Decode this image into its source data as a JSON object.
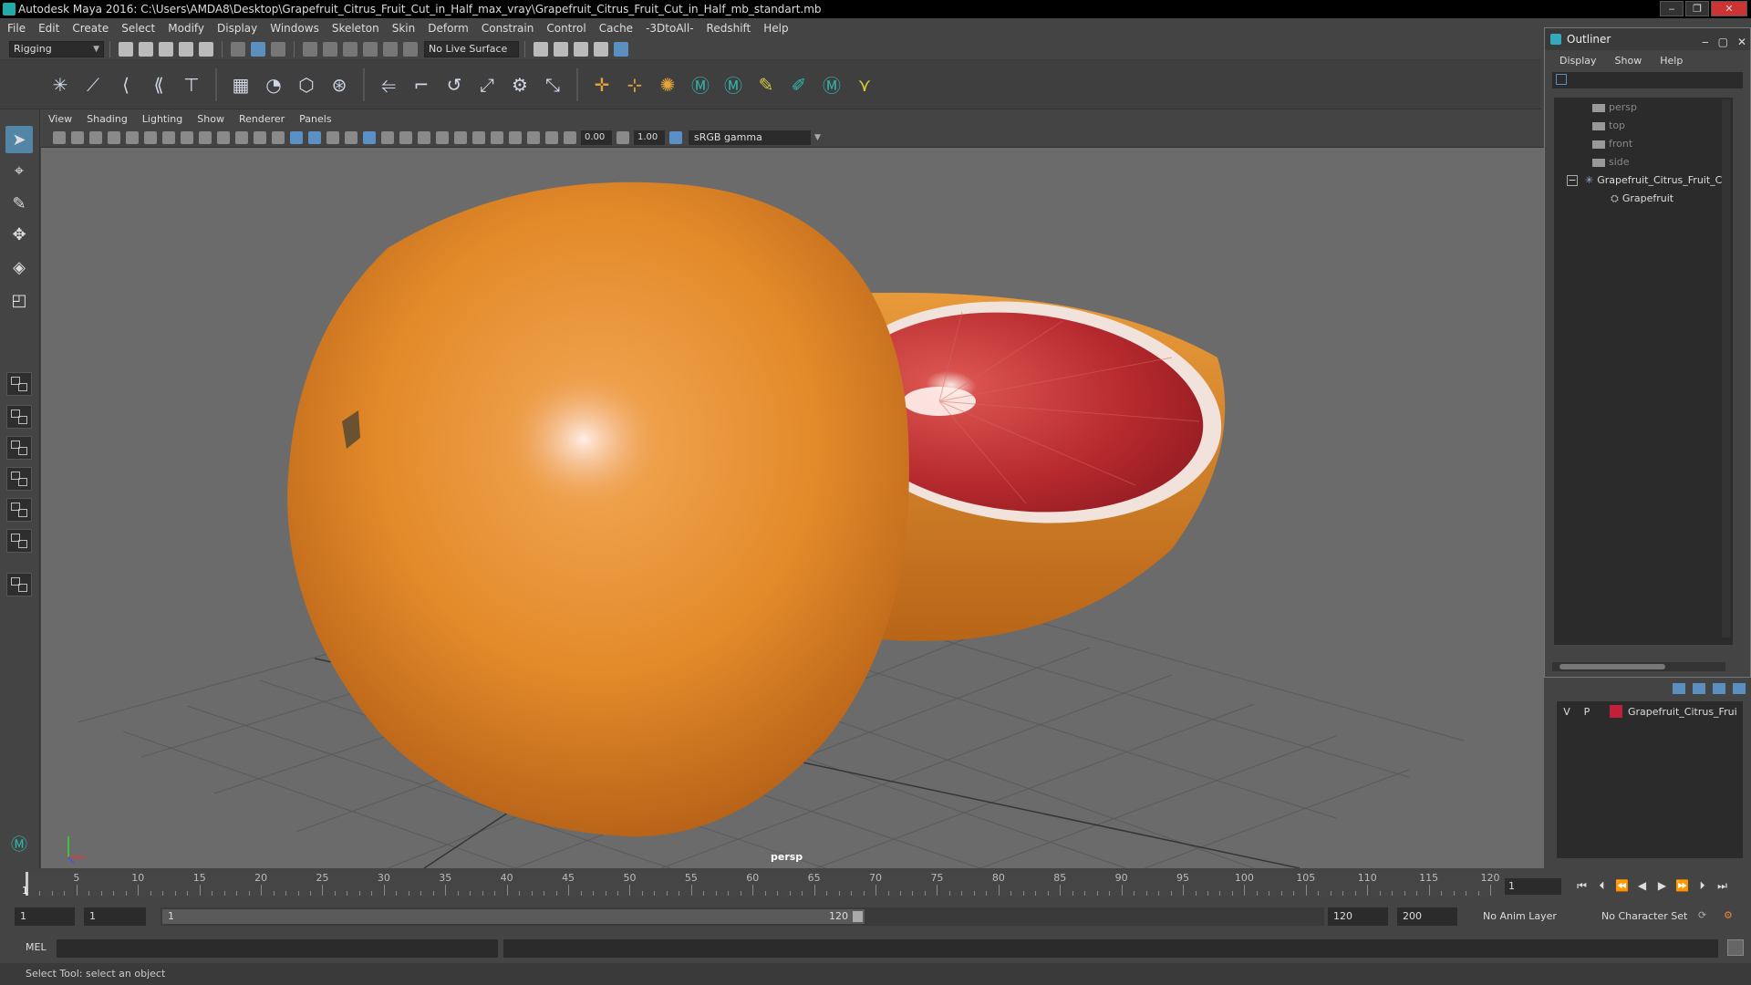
{
  "window": {
    "title": "Autodesk Maya 2016: C:\\Users\\AMDA8\\Desktop\\Grapefruit_Citrus_Fruit_Cut_in_Half_max_vray\\Grapefruit_Citrus_Fruit_Cut_in_Half_mb_standart.mb",
    "minimize": "‒",
    "restore": "❐",
    "close": "✕"
  },
  "menu": [
    "File",
    "Edit",
    "Create",
    "Select",
    "Modify",
    "Display",
    "Windows",
    "Skeleton",
    "Skin",
    "Deform",
    "Constrain",
    "Control",
    "Cache",
    "-3DtoAll-",
    "Redshift",
    "Help"
  ],
  "statusline": {
    "mode": "Rigging",
    "live_surface": "No Live Surface"
  },
  "panel": {
    "menu": [
      "View",
      "Shading",
      "Lighting",
      "Show",
      "Renderer",
      "Panels"
    ],
    "exposure": "0.00",
    "gamma_value": "1.00",
    "color_space": "sRGB gamma",
    "camera_label": "persp"
  },
  "outliner": {
    "title": "Outliner",
    "menu": [
      "Display",
      "Show",
      "Help"
    ],
    "items": [
      {
        "label": "persp",
        "type": "camera"
      },
      {
        "label": "top",
        "type": "camera"
      },
      {
        "label": "front",
        "type": "camera"
      },
      {
        "label": "side",
        "type": "camera"
      },
      {
        "label": "Grapefruit_Citrus_Fruit_Cu",
        "type": "group",
        "expand": "−"
      },
      {
        "label": "Grapefruit",
        "type": "mesh"
      }
    ]
  },
  "layers": {
    "rows": [
      {
        "v": "V",
        "p": "P",
        "color": "#c0203a",
        "name": "Grapefruit_Citrus_Frui"
      }
    ]
  },
  "timeline": {
    "ticks": [
      5,
      10,
      15,
      20,
      25,
      30,
      35,
      40,
      45,
      50,
      55,
      60,
      65,
      70,
      75,
      80,
      85,
      90,
      95,
      100,
      105,
      110,
      115,
      120
    ],
    "current": "1",
    "current_field": "1"
  },
  "range": {
    "start": "1",
    "playback_start": "1",
    "thumb_start": "1",
    "thumb_end": "120",
    "playback_end": "120",
    "end": "200",
    "anim_layer": "No Anim Layer",
    "char_set": "No Character Set"
  },
  "cmdline": {
    "label": "MEL"
  },
  "helpline": {
    "text": "Select Tool: select an object"
  }
}
